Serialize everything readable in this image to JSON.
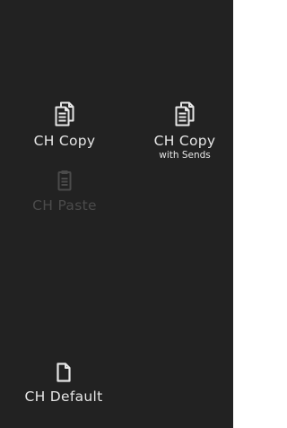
{
  "buttons": {
    "ch_copy": {
      "label": "CH Copy",
      "icon": "copy-icon"
    },
    "ch_copy_with_sends": {
      "label": "CH Copy",
      "sublabel": "with Sends",
      "icon": "copy-icon"
    },
    "ch_paste": {
      "label": "CH Paste",
      "icon": "clipboard-icon",
      "state": "disabled"
    },
    "ch_default": {
      "label": "CH Default",
      "icon": "document-icon"
    }
  },
  "colors": {
    "panel_background": "#222222",
    "label_enabled": "#e6e6e6",
    "label_disabled": "#4b4b4b",
    "page_background": "#ffffff"
  }
}
